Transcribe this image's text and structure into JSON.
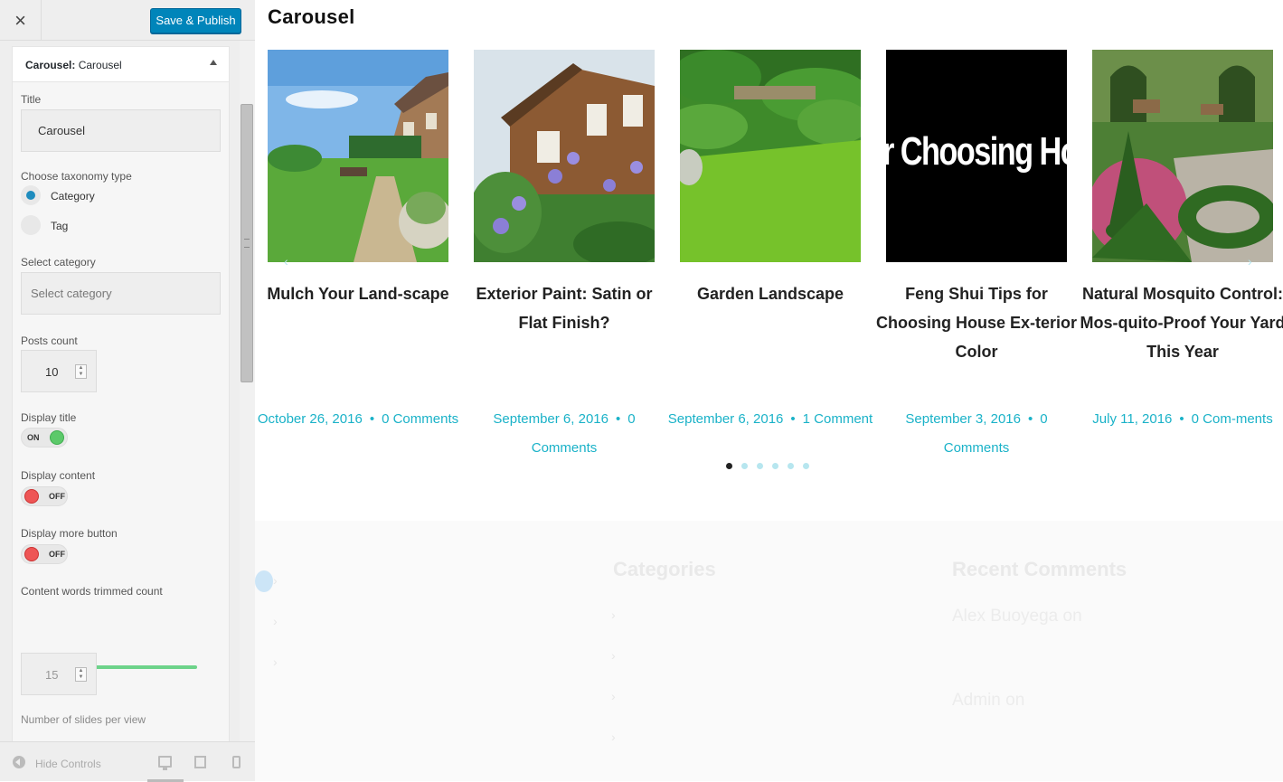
{
  "customizer": {
    "close_glyph": "×",
    "save_label": "Save & Publish",
    "widget_title_prefix": "Carousel:",
    "widget_title_name": "Carousel",
    "fields": {
      "title_label": "Title",
      "title_value": "Carousel",
      "taxonomy_label": "Choose taxonomy type",
      "taxonomy_options": [
        "Category",
        "Tag"
      ],
      "taxonomy_selected": "Category",
      "category_label": "Select category",
      "category_placeholder": "Select category",
      "posts_count_label": "Posts count",
      "posts_count": "10",
      "display_title_label": "Display title",
      "display_title_state": "ON",
      "display_content_label": "Display content",
      "display_content_state": "OFF",
      "display_more_label": "Display more button",
      "display_more_state": "OFF",
      "words_trimmed_label": "Content words trimmed count",
      "words_trimmed_slider_fraction": 0.3,
      "words_trimmed_value": "15",
      "slides_per_view_label": "Number of slides per view"
    },
    "footer": {
      "hide_controls_label": "Hide Controls",
      "devices": [
        "desktop-icon",
        "tablet-icon",
        "mobile-icon"
      ]
    }
  },
  "preview": {
    "heading": "Carousel",
    "slides": [
      {
        "title": "Mulch Your Land-scape",
        "date": "October 26, 2016",
        "comments": "0 Comments",
        "image": "lawn-garden-house"
      },
      {
        "title": "Exterior Paint: Satin or Flat Finish?",
        "date": "September 6, 2016",
        "comments": "0 Comments",
        "image": "wooden-house-flowers"
      },
      {
        "title": "Garden Landscape",
        "date": "September 6, 2016",
        "comments": "1 Comment",
        "image": "green-lawn-garden"
      },
      {
        "title": "Feng Shui Tips for Choosing House Ex-terior Color",
        "date": "September 3, 2016",
        "comments": "0 Comments",
        "image": "text-banner",
        "banner_text": "r Choosing Hou"
      },
      {
        "title": "Natural Mosquito Control: Mos-quito-Proof Your Yard This Year",
        "date": "July 11, 2016",
        "comments": "0 Com-ments",
        "image": "topiary-garden"
      }
    ],
    "dots_count": 6,
    "active_dot": 0,
    "footer": {
      "categories_heading": "Categories",
      "recent_comments_heading": "Recent Comments",
      "comment_author_1": "Alex Buoyega",
      "comment_author_2": "Admin",
      "on_word": "on"
    },
    "colors": {
      "accent": "#1ab2c8",
      "save_button": "#0085ba",
      "toggle_on": "#5cc96a",
      "toggle_off": "#ee5555"
    }
  }
}
